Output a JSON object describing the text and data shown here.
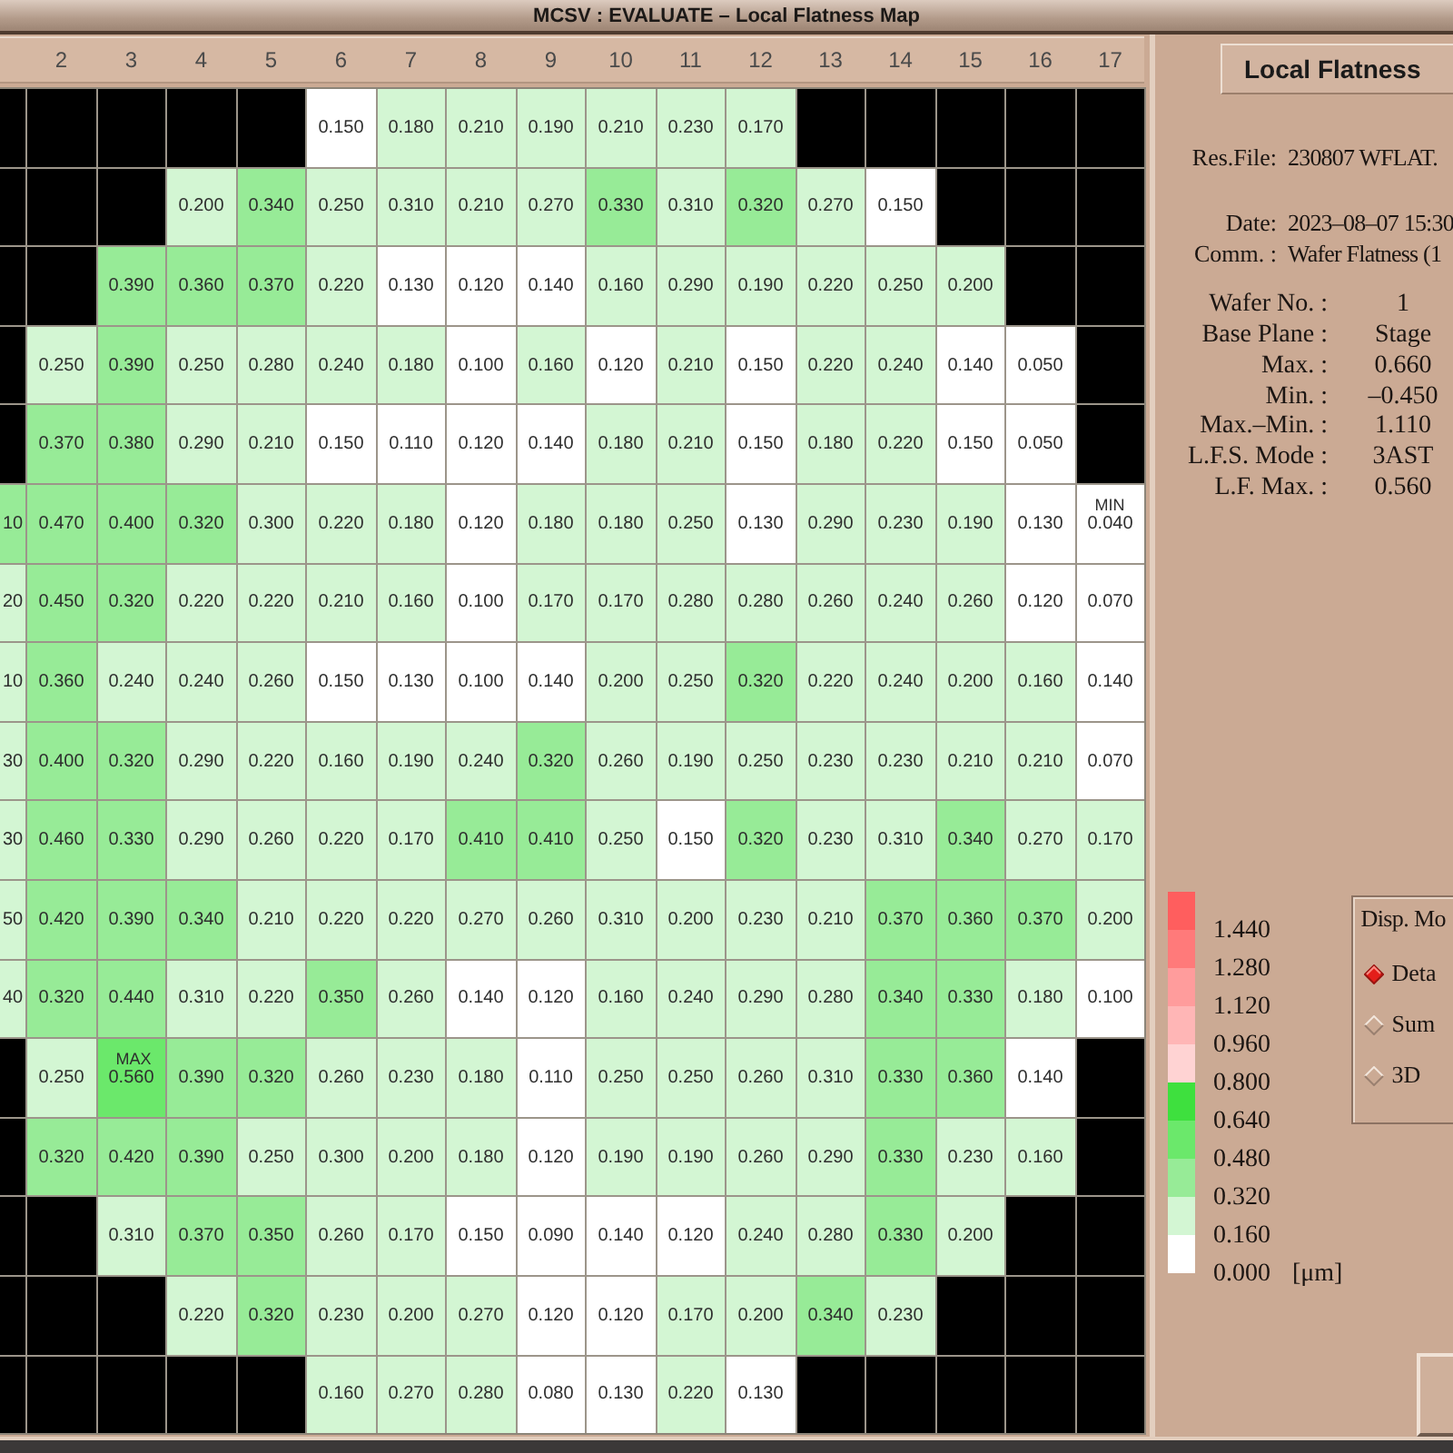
{
  "window": {
    "title": "MCSV : EVALUATE – Local Flatness Map"
  },
  "map": {
    "columns": [
      null,
      "2",
      "3",
      "4",
      "5",
      "6",
      "7",
      "8",
      "9",
      "10",
      "11",
      "12",
      "13",
      "14",
      "15",
      "16",
      "17"
    ],
    "rows": [
      [
        null,
        null,
        null,
        null,
        null,
        "0.150",
        "0.180",
        "0.210",
        "0.190",
        "0.210",
        "0.230",
        "0.170",
        null,
        null,
        null,
        null,
        null
      ],
      [
        null,
        null,
        null,
        "0.200",
        "0.340",
        "0.250",
        "0.310",
        "0.210",
        "0.270",
        "0.330",
        "0.310",
        "0.320",
        "0.270",
        "0.150",
        null,
        null,
        null
      ],
      [
        null,
        null,
        "0.390",
        "0.360",
        "0.370",
        "0.220",
        "0.130",
        "0.120",
        "0.140",
        "0.160",
        "0.290",
        "0.190",
        "0.220",
        "0.250",
        "0.200",
        null,
        null
      ],
      [
        null,
        "0.250",
        "0.390",
        "0.250",
        "0.280",
        "0.240",
        "0.180",
        "0.100",
        "0.160",
        "0.120",
        "0.210",
        "0.150",
        "0.220",
        "0.240",
        "0.140",
        "0.050",
        null
      ],
      [
        null,
        "0.370",
        "0.380",
        "0.290",
        "0.210",
        "0.150",
        "0.110",
        "0.120",
        "0.140",
        "0.180",
        "0.210",
        "0.150",
        "0.180",
        "0.220",
        "0.150",
        "0.050",
        null
      ],
      [
        {
          "value": "10",
          "color": "#97eb97"
        },
        "0.470",
        "0.400",
        "0.320",
        "0.300",
        "0.220",
        "0.180",
        "0.120",
        "0.180",
        "0.180",
        "0.250",
        "0.130",
        "0.290",
        "0.230",
        "0.190",
        "0.130",
        {
          "value": "0.040",
          "tag": "MIN"
        }
      ],
      [
        {
          "value": "20",
          "color": "#d3f6d3"
        },
        "0.450",
        "0.320",
        "0.220",
        "0.220",
        "0.210",
        "0.160",
        "0.100",
        "0.170",
        "0.170",
        "0.280",
        "0.280",
        "0.260",
        "0.240",
        "0.260",
        "0.120",
        "0.070"
      ],
      [
        {
          "value": "10",
          "color": "#d3f6d3"
        },
        "0.360",
        "0.240",
        "0.240",
        "0.260",
        "0.150",
        "0.130",
        "0.100",
        "0.140",
        "0.200",
        "0.250",
        "0.320",
        "0.220",
        "0.240",
        "0.200",
        "0.160",
        "0.140"
      ],
      [
        {
          "value": "30",
          "color": "#d3f6d3"
        },
        "0.400",
        "0.320",
        "0.290",
        "0.220",
        "0.160",
        "0.190",
        "0.240",
        "0.320",
        "0.260",
        "0.190",
        "0.250",
        "0.230",
        "0.230",
        "0.210",
        "0.210",
        "0.070"
      ],
      [
        {
          "value": "30",
          "color": "#d3f6d3"
        },
        "0.460",
        "0.330",
        "0.290",
        "0.260",
        "0.220",
        "0.170",
        "0.410",
        "0.410",
        "0.250",
        "0.150",
        "0.320",
        "0.230",
        "0.310",
        "0.340",
        "0.270",
        "0.170"
      ],
      [
        {
          "value": "50",
          "color": "#d3f6d3"
        },
        "0.420",
        "0.390",
        "0.340",
        "0.210",
        "0.220",
        "0.220",
        "0.270",
        "0.260",
        "0.310",
        "0.200",
        "0.230",
        "0.210",
        "0.370",
        "0.360",
        "0.370",
        "0.200"
      ],
      [
        {
          "value": "40",
          "color": "#d3f6d3"
        },
        "0.320",
        "0.440",
        "0.310",
        "0.220",
        "0.350",
        "0.260",
        "0.140",
        "0.120",
        "0.160",
        "0.240",
        "0.290",
        "0.280",
        "0.340",
        "0.330",
        "0.180",
        "0.100"
      ],
      [
        null,
        "0.250",
        {
          "value": "0.560",
          "tag": "MAX"
        },
        "0.390",
        "0.320",
        "0.260",
        "0.230",
        "0.180",
        "0.110",
        "0.250",
        "0.250",
        "0.260",
        "0.310",
        "0.330",
        "0.360",
        "0.140",
        null
      ],
      [
        null,
        "0.320",
        "0.420",
        "0.390",
        "0.250",
        "0.300",
        "0.200",
        "0.180",
        "0.120",
        "0.190",
        "0.190",
        "0.260",
        "0.290",
        "0.330",
        "0.230",
        "0.160",
        null
      ],
      [
        null,
        null,
        "0.310",
        "0.370",
        "0.350",
        "0.260",
        "0.170",
        "0.150",
        "0.090",
        "0.140",
        "0.120",
        "0.240",
        "0.280",
        "0.330",
        "0.200",
        null,
        null
      ],
      [
        null,
        null,
        null,
        "0.220",
        "0.320",
        "0.230",
        "0.200",
        "0.270",
        "0.120",
        "0.120",
        "0.170",
        "0.200",
        "0.340",
        "0.230",
        null,
        null,
        null
      ],
      [
        null,
        null,
        null,
        null,
        null,
        "0.160",
        "0.270",
        "0.280",
        "0.080",
        "0.130",
        "0.220",
        "0.130",
        null,
        null,
        null,
        null,
        null
      ]
    ]
  },
  "panel": {
    "title": "Local Flatness",
    "file_info": [
      {
        "label": "Res.File:",
        "value": "230807 WFLAT."
      },
      {
        "label": "Date:",
        "value": "2023–08–07 15:30"
      },
      {
        "label": "Comm. :",
        "value": "Wafer Flatness (1"
      }
    ],
    "results": [
      {
        "label": "Wafer No. :",
        "value": "1"
      },
      {
        "label": "Base Plane :",
        "value": "Stage"
      },
      {
        "label": "Max. :",
        "value": "0.660"
      },
      {
        "label": "Min. :",
        "value": "–0.450"
      },
      {
        "label": "Max.–Min. :",
        "value": "1.110"
      },
      {
        "label": "L.F.S. Mode :",
        "value": "3AST"
      },
      {
        "label": "L.F. Max. :",
        "value": "0.560"
      }
    ]
  },
  "legend": {
    "bands": [
      {
        "color": "#ff5e5e"
      },
      {
        "color": "#ff7a7a"
      },
      {
        "color": "#ff9c9c"
      },
      {
        "color": "#ffb6b6"
      },
      {
        "color": "#ffd3d3"
      },
      {
        "color": "#3ee03e"
      },
      {
        "color": "#6be86b"
      },
      {
        "color": "#97eb97"
      },
      {
        "color": "#d3f6d3"
      },
      {
        "color": "#ffffff"
      }
    ],
    "ticks": [
      "1.440",
      "1.280",
      "1.120",
      "0.960",
      "0.800",
      "0.640",
      "0.480",
      "0.320",
      "0.160",
      "0.000"
    ],
    "unit": "[μm]"
  },
  "disp_mode": {
    "title": "Disp. Mo",
    "options": [
      {
        "label": "Deta",
        "selected": true
      },
      {
        "label": "Sum",
        "selected": false
      },
      {
        "label": "3D",
        "selected": false
      }
    ]
  }
}
